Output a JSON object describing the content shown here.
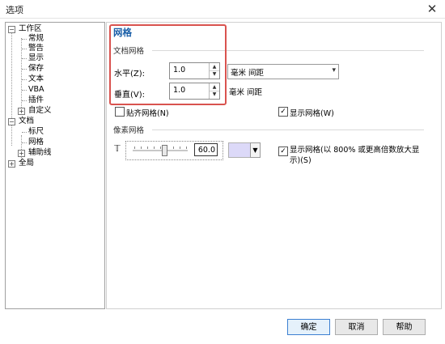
{
  "window": {
    "title": "选项",
    "close_glyph": "✕"
  },
  "tree": [
    {
      "label": "工作区",
      "level": 0,
      "expander": "−"
    },
    {
      "label": "常规",
      "level": 1
    },
    {
      "label": "警告",
      "level": 1
    },
    {
      "label": "显示",
      "level": 1
    },
    {
      "label": "保存",
      "level": 1
    },
    {
      "label": "文本",
      "level": 1
    },
    {
      "label": "VBA",
      "level": 1
    },
    {
      "label": "插件",
      "level": 1
    },
    {
      "label": "自定义",
      "level": 1,
      "expander": "+"
    },
    {
      "label": "文档",
      "level": 0,
      "expander": "−"
    },
    {
      "label": "标尺",
      "level": 1
    },
    {
      "label": "网格",
      "level": 1
    },
    {
      "label": "辅助线",
      "level": 1,
      "expander": "+"
    },
    {
      "label": "全局",
      "level": 0,
      "expander": "+"
    }
  ],
  "panel": {
    "heading": "网格",
    "doc_grid": {
      "section_label": "文档网格",
      "horizontal": {
        "label": "水平(Z):",
        "value": "1.0"
      },
      "vertical": {
        "label": "垂直(V):",
        "value": "1.0"
      },
      "unit_select": "毫米 间距",
      "vertical_unit": "毫米 间距",
      "snap_label": "贴齐网格(N)",
      "snap_checked": false,
      "show_label": "显示网格(W)",
      "show_checked": true
    },
    "pixel_grid": {
      "section_label": "像素网格",
      "opacity_value": "60.0",
      "swatch_color": "#dcd9f8",
      "show_label": "显示网格(以 800% 或更高倍数放大显示)(S)",
      "show_checked": true
    }
  },
  "buttons": {
    "ok": "确定",
    "cancel": "取消",
    "help": "帮助"
  },
  "colors": {
    "heading": "#1a5fa8",
    "highlight": "#d9534f",
    "accent": "#3c7fd1"
  }
}
